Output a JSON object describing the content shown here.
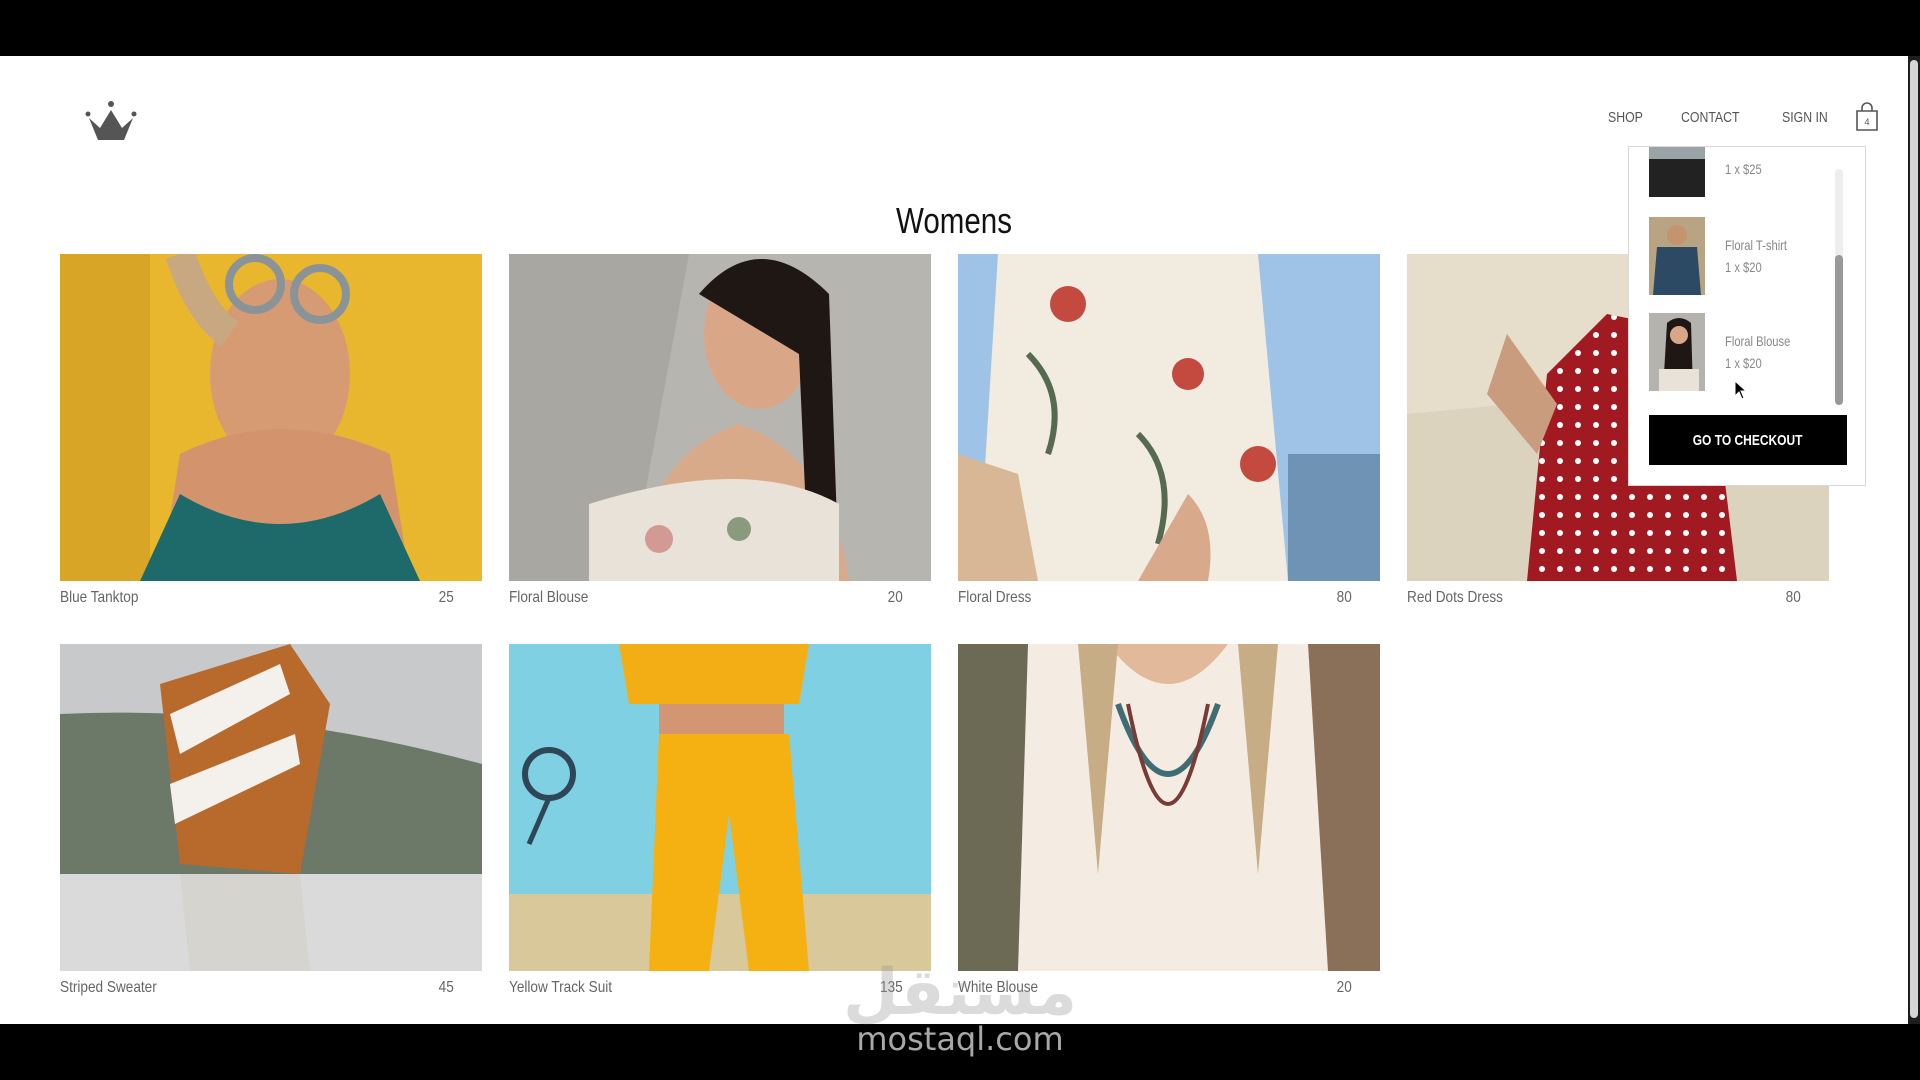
{
  "nav": {
    "shop": "SHOP",
    "contact": "CONTACT",
    "sign_in": "SIGN IN"
  },
  "page": {
    "title": "Womens"
  },
  "products": [
    {
      "name": "Blue Tanktop",
      "price": "25"
    },
    {
      "name": "Floral Blouse",
      "price": "20"
    },
    {
      "name": "Floral Dress",
      "price": "80"
    },
    {
      "name": "Red Dots Dress",
      "price": "80"
    },
    {
      "name": "Striped Sweater",
      "price": "45"
    },
    {
      "name": "Yellow Track Suit",
      "price": "135"
    },
    {
      "name": "White Blouse",
      "price": "20"
    }
  ],
  "cart": {
    "items": [
      {
        "name": "",
        "qty": "1 x $25"
      },
      {
        "name": "Floral T-shirt",
        "qty": "1 x $20"
      },
      {
        "name": "Floral Blouse",
        "qty": "1 x $20"
      }
    ],
    "checkout_label": "GO TO CHECKOUT"
  },
  "watermark": {
    "arabic": "مستقل",
    "latin": "mostaql.com"
  },
  "icons": [
    "crown-logo-icon",
    "shopping-bag-icon",
    "mouse-cursor-icon"
  ]
}
